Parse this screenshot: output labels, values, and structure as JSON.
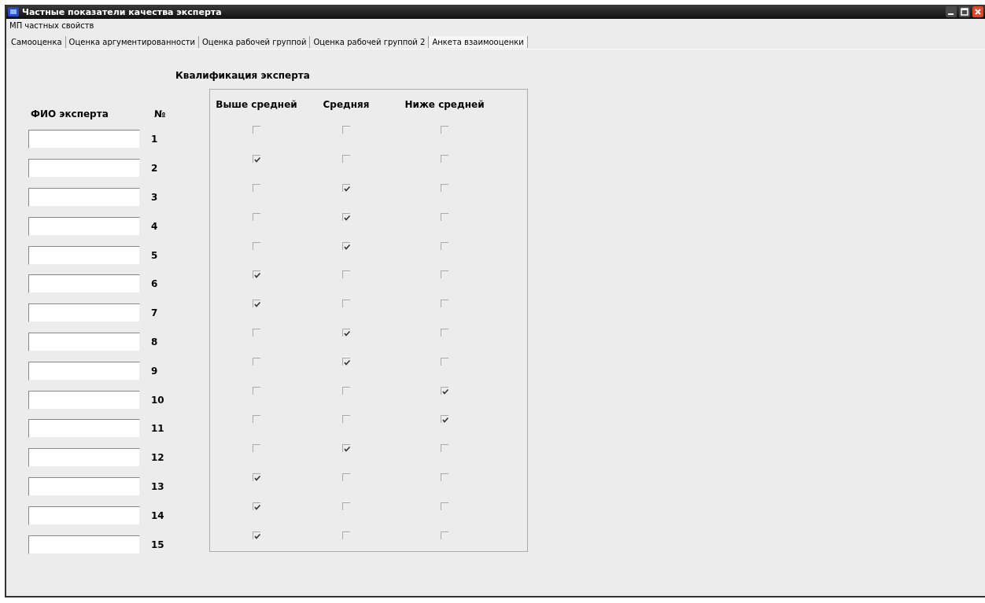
{
  "window": {
    "title": "Частные показатели качества эксперта"
  },
  "menu": [
    "МП частных свойств"
  ],
  "tabs": [
    {
      "label": "Самооценка",
      "selected": false
    },
    {
      "label": "Оценка аргументированности",
      "selected": false
    },
    {
      "label": "Оценка рабочей группой",
      "selected": false
    },
    {
      "label": "Оценка рабочей группой 2",
      "selected": false
    },
    {
      "label": "Анкета взаимооценки",
      "selected": true
    }
  ],
  "form": {
    "heading": "Квалификация эксперта",
    "name_header": "ФИО эксперта",
    "number_header": "№",
    "level_headers": [
      "Выше средней",
      "Средняя",
      "Ниже средней"
    ],
    "rows": [
      {
        "number": "1",
        "checks": [
          false,
          false,
          false
        ]
      },
      {
        "number": "2",
        "checks": [
          true,
          false,
          false
        ]
      },
      {
        "number": "3",
        "checks": [
          false,
          true,
          false
        ]
      },
      {
        "number": "4",
        "checks": [
          false,
          true,
          false
        ]
      },
      {
        "number": "5",
        "checks": [
          false,
          true,
          false
        ]
      },
      {
        "number": "6",
        "checks": [
          true,
          false,
          false
        ]
      },
      {
        "number": "7",
        "checks": [
          true,
          false,
          false
        ]
      },
      {
        "number": "8",
        "checks": [
          false,
          true,
          false
        ]
      },
      {
        "number": "9",
        "checks": [
          false,
          true,
          false
        ]
      },
      {
        "number": "10",
        "checks": [
          false,
          false,
          true
        ]
      },
      {
        "number": "11",
        "checks": [
          false,
          false,
          true
        ]
      },
      {
        "number": "12",
        "checks": [
          false,
          true,
          false
        ]
      },
      {
        "number": "13",
        "checks": [
          true,
          false,
          false
        ]
      },
      {
        "number": "14",
        "checks": [
          true,
          false,
          false
        ]
      },
      {
        "number": "15",
        "checks": [
          true,
          false,
          false
        ]
      }
    ]
  }
}
